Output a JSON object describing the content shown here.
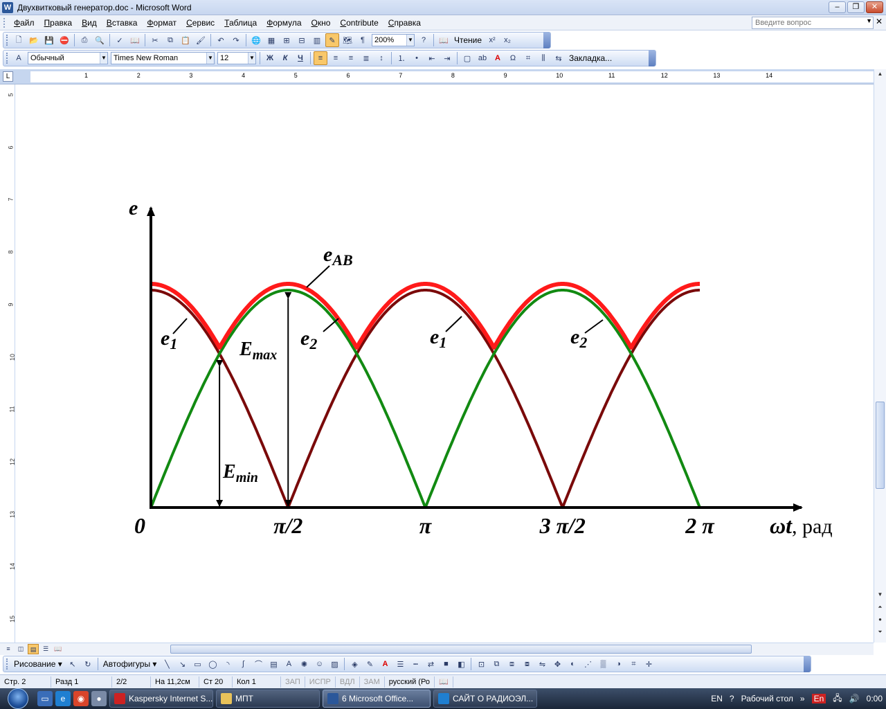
{
  "window": {
    "title": "Двухвитковый генератор.doc - Microsoft Word",
    "app_icon": "word-icon"
  },
  "menu": {
    "items": [
      "Файл",
      "Правка",
      "Вид",
      "Вставка",
      "Формат",
      "Сервис",
      "Таблица",
      "Формула",
      "Окно",
      "Contribute",
      "Справка"
    ],
    "help_placeholder": "Введите вопрос"
  },
  "toolbar_standard": {
    "zoom": "200%",
    "read_label": "Чтение"
  },
  "toolbar_format": {
    "style": "Обычный",
    "font": "Times New Roman",
    "size": "12",
    "bold": "Ж",
    "italic": "К",
    "underline": "Ч",
    "bookmark": "Закладка..."
  },
  "ruler": {
    "numbers": [
      "1",
      "2",
      "3",
      "4",
      "5",
      "6",
      "7",
      "8",
      "9",
      "10",
      "11",
      "12",
      "13",
      "14"
    ],
    "vertical_numbers": [
      "5",
      "6",
      "7",
      "8",
      "9",
      "10",
      "11",
      "12",
      "13",
      "14",
      "15"
    ]
  },
  "drawing_toolbar": {
    "draw_label": "Рисование",
    "autoshapes_label": "Автофигуры"
  },
  "statusbar": {
    "page": "Стр. 2",
    "section": "Разд 1",
    "pages": "2/2",
    "at": "На 11,2см",
    "line": "Ст 20",
    "col": "Кол 1",
    "rec": "ЗАП",
    "trk": "ИСПР",
    "ext": "ВДЛ",
    "ovr": "ЗАМ",
    "lang": "русский (Ро"
  },
  "taskbar": {
    "tasks": [
      "Kaspersky Internet S...",
      "МПТ",
      "6 Microsoft Office...",
      "САЙТ О РАДИОЭЛ..."
    ],
    "lang": "EN",
    "desktop": "Рабочий стол",
    "tray_lang": "En",
    "clock": "0:00"
  },
  "chart_data": {
    "type": "line",
    "x_ticks": [
      "0",
      "π/2",
      "π",
      "3 π/2",
      "2 π"
    ],
    "x_values": [
      0,
      1.5708,
      3.1416,
      4.7124,
      6.2832
    ],
    "y_axis_label": "e",
    "x_axis_label_symbol": "ωt",
    "x_axis_label_unit": ", рад",
    "series": [
      {
        "name": "e1",
        "color": "#7a0a0a",
        "function": "|cos(ωt)|",
        "peak": 1.0
      },
      {
        "name": "e2",
        "color": "#128a12",
        "function": "|sin(ωt)|",
        "peak": 1.0
      },
      {
        "name": "eAB",
        "color": "#ff1a1a",
        "function": "max(|sin ωt|,|cos ωt|)",
        "peak": 1.0,
        "min": 0.7071
      }
    ],
    "annotations": {
      "e1_left": "e",
      "e1_left_sub": "1",
      "e2_left": "e",
      "e2_left_sub": "2",
      "e1_right": "e",
      "e1_right_sub": "1",
      "e2_right": "e",
      "e2_right_sub": "2",
      "eab": "e",
      "eab_sub": "AB",
      "emax": "E",
      "emax_sub": "max",
      "emin": "E",
      "emin_sub": "min"
    },
    "xlim": [
      0,
      6.2832
    ],
    "ylim": [
      0,
      1.1
    ]
  }
}
